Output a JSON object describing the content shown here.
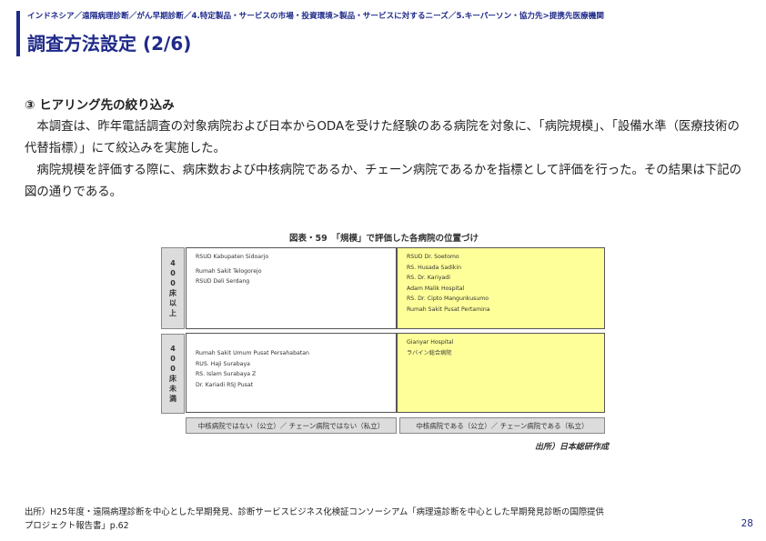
{
  "header": {
    "breadcrumb": "インドネシア／遠隔病理診断／がん早期診断／4.特定製品・サービスの市場・投資環境>製品・サービスに対するニーズ／5.キーパーソン・協力先>提携先医療機関",
    "title": "調査方法設定 (2/6)"
  },
  "section": {
    "heading": "③ ヒアリング先の絞り込み",
    "paragraphs": [
      "本調査は、昨年電話調査の対象病院および日本からODAを受けた経験のある病院を対象に、「病院規模」、「設備水準（医療技術の代替指標）」にて絞込みを実施した。",
      "病院規模を評価する際に、病床数および中核病院であるか、チェーン病院であるかを指標として評価を行った。その結果は下記の図の通りである。"
    ]
  },
  "figure": {
    "title": "図表・59　「規模」で評価した各病院の位置づけ",
    "rows": [
      {
        "label": "400床以上"
      },
      {
        "label": "400床未満"
      }
    ],
    "cells": {
      "top_left": [
        "RSUD Kabupaten Sidoarjo",
        "Rumah Sakit Telogorejo",
        "RSUD Deli Serdang"
      ],
      "top_right": [
        "RSUD Dr. Soetomo",
        "RS. Husada Sadikin",
        "RS. Dr. Kariyadi",
        "Adam Malik Hospital",
        "RS. Dr. Cipto Mangunkusumo",
        "Rumah Sakit Pusat Pertamina"
      ],
      "bottom_left": [
        "Rumah Sakit Umum Pusat Persahabatan",
        "RUS. Haji Surabaya",
        "RS. Islam Surabaya Z",
        "Dr. Kariadi RSJ Pusat"
      ],
      "bottom_right": [
        "Gianyar Hospital",
        "ラバイン総合病院"
      ]
    },
    "columns": [
      "中核病院ではない（公立）／ チェーン病院ではない（私立）",
      "中核病院である（公立）／ チェーン病院である（私立）"
    ],
    "source": "出所）日本総研作成",
    "colors": {
      "yellow": "#ffff99",
      "label_gray": "#dcdcdc"
    }
  },
  "footer": {
    "note_line1": "出所）H25年度・遠隔病理診断を中心とした早期発見、診断サービスビジネス化検証コンソーシアム「病理遠診断を中心とした早期発見診断の国際提供",
    "note_line2": "プロジェクト報告書」p.62",
    "page_number": "28"
  },
  "theme": {
    "accent": "#1f2a8a"
  }
}
